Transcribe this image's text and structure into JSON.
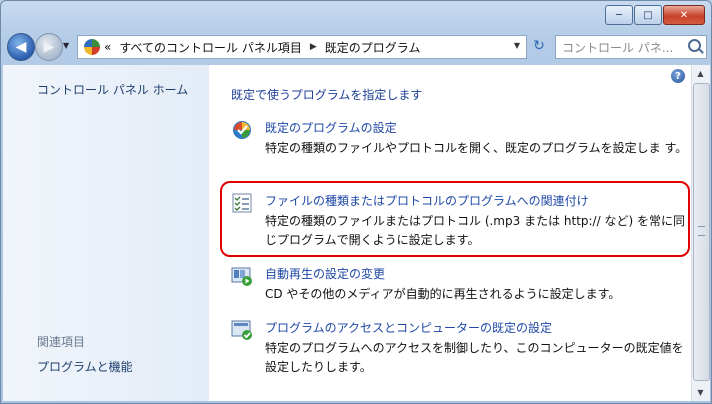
{
  "window": {
    "minimize": "─",
    "maximize": "□",
    "close": "✕"
  },
  "nav": {
    "back": "◀",
    "forward": "▶",
    "dropdown": "▼",
    "address_prefix": "«",
    "address_path": "すべてのコントロール パネル項目",
    "address_sep": "▶",
    "address_current": "既定のプログラム",
    "address_dropdown": "▼",
    "refresh": "↻",
    "search_placeholder": "コントロール パネ..."
  },
  "sidebar": {
    "home": "コントロール パネル ホーム",
    "related_heading": "関連項目",
    "related_link": "プログラムと機能"
  },
  "main": {
    "help": "?",
    "heading": "既定で使うプログラムを指定します",
    "items": [
      {
        "title": "既定のプログラムの設定",
        "desc": "特定の種類のファイルやプロトコルを開く、既定のプログラムを設定しま す。",
        "icon": "default-programs-icon"
      },
      {
        "title": "ファイルの種類またはプロトコルのプログラムへの関連付け",
        "desc": "特定の種類のファイルまたはプロトコル (.mp3 または http:// など) を常に同じプログラムで開くように設定します。",
        "icon": "file-association-icon"
      },
      {
        "title": "自動再生の設定の変更",
        "desc": "CD やその他のメディアが自動的に再生されるように設定します。",
        "icon": "autoplay-icon"
      },
      {
        "title": "プログラムのアクセスとコンピューターの既定の設定",
        "desc": "特定のプログラムへのアクセスを制御したり、このコンピューターの既定値を設定したりします。",
        "icon": "program-access-icon"
      }
    ]
  },
  "scrollbar": {
    "up": "▲",
    "down": "▼"
  },
  "colors": {
    "link": "#1f48a6",
    "highlight": "#e00000"
  }
}
